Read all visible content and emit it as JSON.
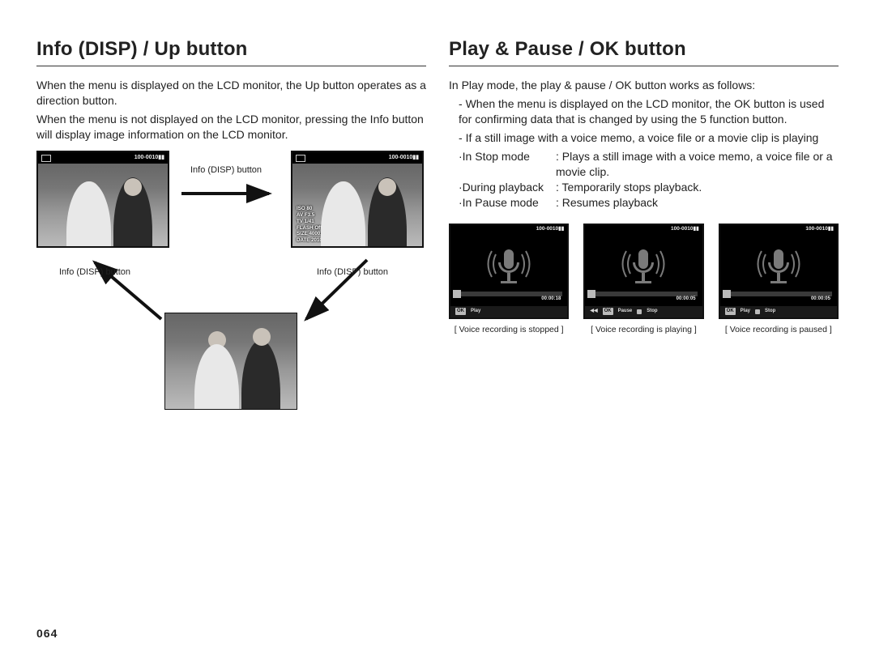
{
  "page_number": "064",
  "left": {
    "heading": "Info (DISP) / Up button",
    "paragraphs": [
      "When the menu is displayed on the LCD monitor, the Up button operates as a direction button.",
      "When the menu is not displayed on the LCD monitor, pressing the Info button will display image information on the LCD monitor."
    ],
    "arrow_label": "Info (DISP) button",
    "tile_header": "100-0010",
    "tile_meta_lines": "ISO 80\nAV F3.5\nTV 1/41\nFLASH Off\nSIZE 4000x3000\nDATE 2010.01.01"
  },
  "right": {
    "heading": "Play & Pause / OK button",
    "intro": "In Play mode, the play & pause / OK button works as follows:",
    "bullets": [
      "When the menu is displayed on the LCD monitor, the OK button is used for confirming data that is changed by using the 5 function button.",
      "If a still image with a voice memo, a voice file or a movie clip is playing"
    ],
    "modes": [
      {
        "label": "·In Stop mode",
        "desc": ": Plays a still image with a voice memo, a voice file or a movie clip."
      },
      {
        "label": "·During playback",
        "desc": ": Temporarily stops playback."
      },
      {
        "label": "·In Pause mode",
        "desc": ": Resumes playback"
      }
    ],
    "thumbs": [
      {
        "file": "100-0010",
        "time": "00:00:18",
        "bar": [
          [
            "OK",
            "Play"
          ]
        ],
        "caption": "[ Voice recording is stopped ]"
      },
      {
        "file": "100-0010",
        "time": "00:00:05",
        "bar": [
          [
            "OK",
            "Pause"
          ],
          [
            "▶",
            "Stop"
          ]
        ],
        "caption": "[ Voice recording is playing ]"
      },
      {
        "file": "100-0010",
        "time": "00:00:05",
        "bar": [
          [
            "OK",
            "Play"
          ],
          [
            "▶",
            "Stop"
          ]
        ],
        "caption": "[ Voice recording is paused ]"
      }
    ],
    "rewind_icon": "◀◀"
  }
}
